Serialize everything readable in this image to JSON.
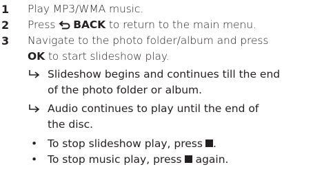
{
  "steps": [
    {
      "number": "1",
      "text": "Play MP3/WMA music."
    },
    {
      "number": "2",
      "before": "Press",
      "key": "BACK",
      "key_icon": "back-arrow-icon",
      "after": "to return to the main menu."
    },
    {
      "number": "3",
      "line1": "Navigate to the photo folder/album and press",
      "key": "OK",
      "line2_rest": "to start slideshow play."
    }
  ],
  "results": [
    {
      "line1": "Slideshow begins and continues till the end",
      "line2": "of the photo folder or album."
    },
    {
      "line1": "Audio continues to play until the end of",
      "line2": "the disc."
    }
  ],
  "bullets": [
    {
      "text": "To stop slideshow play, press",
      "icon": "stop-icon",
      "after": "."
    },
    {
      "text": "To stop music play, press",
      "icon": "stop-icon",
      "after": "again."
    }
  ],
  "colors": {
    "text": "#231f20"
  }
}
